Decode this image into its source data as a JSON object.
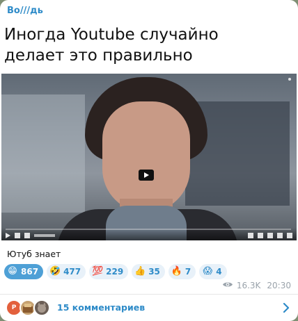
{
  "post": {
    "channel_name": "Во///дь",
    "image_title": "Иногда Youtube случайно делает это правильно",
    "caption": "Ютуб знает",
    "views": "16.3K",
    "time": "20:30"
  },
  "reactions": [
    {
      "emoji": "😁",
      "count": "867",
      "active": true
    },
    {
      "emoji": "🤣",
      "count": "477",
      "active": false
    },
    {
      "emoji": "💯",
      "count": "229",
      "active": false
    },
    {
      "emoji": "👍",
      "count": "35",
      "active": false
    },
    {
      "emoji": "🔥",
      "count": "7",
      "active": false
    },
    {
      "emoji": "😱",
      "count": "4",
      "active": false
    }
  ],
  "comments": {
    "label": "15 комментариев",
    "avatar_initial": "Р"
  },
  "icons": {
    "views": "eye-icon",
    "play": "play-icon",
    "open": "chevron-right-icon"
  },
  "colors": {
    "accent": "#2e8bc8",
    "reaction_bg": "#e8f1f9",
    "reaction_active_bg": "#4ea0d6",
    "meta": "#9aa3ab"
  }
}
